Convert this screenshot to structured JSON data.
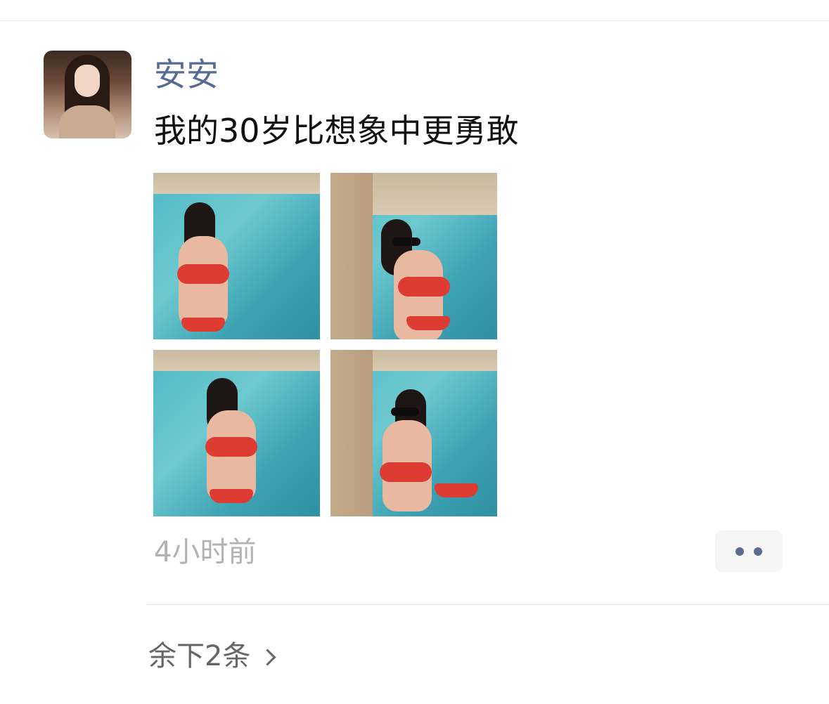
{
  "post": {
    "username": "安安",
    "text": "我的30岁比想象中更勇敢",
    "time": "4小时前"
  },
  "photos": [
    {
      "alt": "photo-1"
    },
    {
      "alt": "photo-2"
    },
    {
      "alt": "photo-3"
    },
    {
      "alt": "photo-4"
    }
  ],
  "actions": {
    "more_icon": "more-dots-icon"
  },
  "footer": {
    "remaining_label": "余下2条",
    "chevron_icon": "chevron-right-icon"
  }
}
